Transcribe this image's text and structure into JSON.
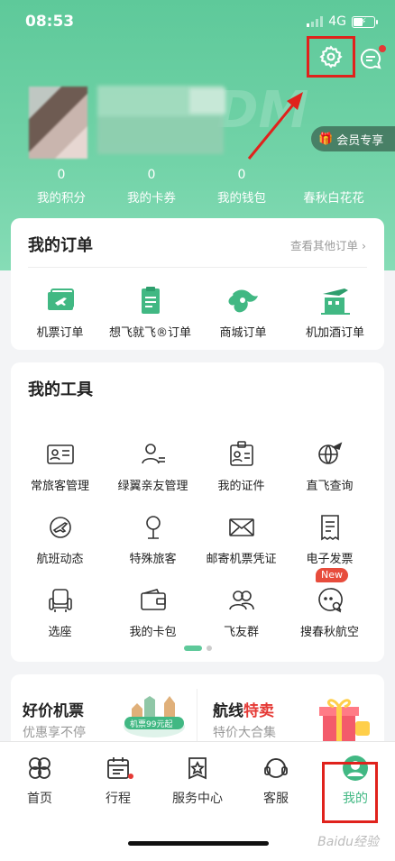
{
  "status_bar": {
    "time": "08:53",
    "network": "4G"
  },
  "profile": {
    "member_label": "会员专享"
  },
  "stats": [
    {
      "value": "0",
      "label": "我的积分"
    },
    {
      "value": "0",
      "label": "我的卡券"
    },
    {
      "value": "0",
      "label": "我的钱包"
    },
    {
      "value": "",
      "label": "春秋白花花"
    }
  ],
  "orders": {
    "title": "我的订单",
    "more": "查看其他订单 ›",
    "items": [
      {
        "label": "机票订单",
        "icon": "plane-ticket-icon"
      },
      {
        "label": "想飞就飞®订单",
        "icon": "clipboard-icon"
      },
      {
        "label": "商城订单",
        "icon": "mall-icon"
      },
      {
        "label": "机加酒订单",
        "icon": "hotel-flight-icon"
      }
    ]
  },
  "tools": {
    "title": "我的工具",
    "items": [
      {
        "label": "常旅客管理",
        "icon": "id-card-icon"
      },
      {
        "label": "绿翼亲友管理",
        "icon": "user-list-icon"
      },
      {
        "label": "我的证件",
        "icon": "badge-icon"
      },
      {
        "label": "直飞查询",
        "icon": "globe-plane-icon"
      },
      {
        "label": "航班动态",
        "icon": "flight-status-icon"
      },
      {
        "label": "特殊旅客",
        "icon": "special-passenger-icon"
      },
      {
        "label": "邮寄机票凭证",
        "icon": "mail-icon"
      },
      {
        "label": "电子发票",
        "icon": "invoice-icon"
      },
      {
        "label": "选座",
        "icon": "seat-icon"
      },
      {
        "label": "我的卡包",
        "icon": "wallet-icon"
      },
      {
        "label": "飞友群",
        "icon": "group-icon"
      },
      {
        "label": "搜春秋航空",
        "icon": "search-chat-icon"
      }
    ],
    "new_badge": "New"
  },
  "promos": [
    {
      "title": "好价机票",
      "subtitle": "优惠享不停",
      "tag": "机票99元起"
    },
    {
      "title_prefix": "航线",
      "title_highlight": "特卖",
      "subtitle": "特价大合集"
    }
  ],
  "tabbar": [
    {
      "label": "首页",
      "icon": "home-logo-icon"
    },
    {
      "label": "行程",
      "icon": "calendar-icon"
    },
    {
      "label": "服务中心",
      "icon": "service-star-icon"
    },
    {
      "label": "客服",
      "icon": "headset-icon"
    },
    {
      "label": "我的",
      "icon": "profile-icon"
    }
  ],
  "colors": {
    "brand": "#5ec99a",
    "accent_red": "#e0221c",
    "active_tab": "#41b883"
  },
  "watermark": "Baidu经验"
}
